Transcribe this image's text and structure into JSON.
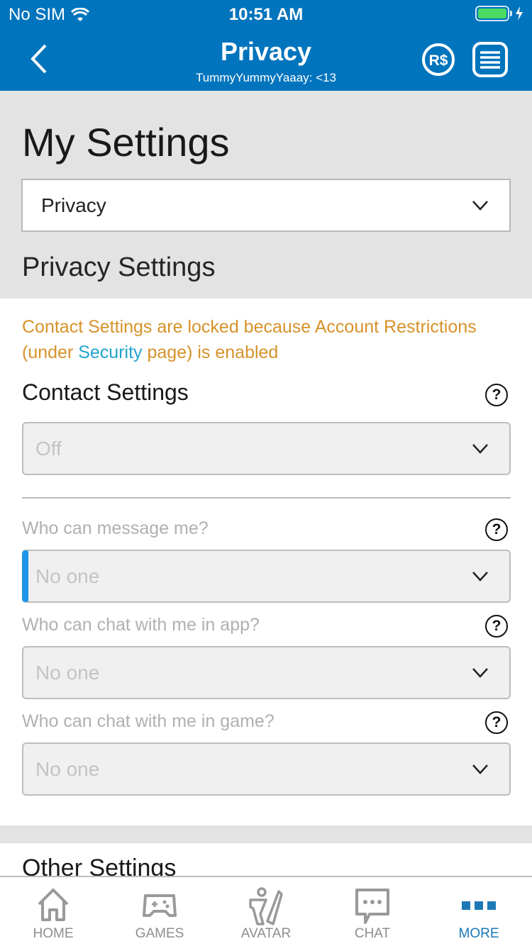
{
  "status_bar": {
    "carrier": "No SIM",
    "time": "10:51 AM"
  },
  "nav": {
    "title": "Privacy",
    "subtitle": "TummyYummyYaaay: <13",
    "back_icon": "chevron-left-icon",
    "robux_icon": "robux-icon",
    "menu_icon": "list-menu-icon"
  },
  "header": {
    "title": "My Settings",
    "category_select": "Privacy",
    "section_title": "Privacy Settings"
  },
  "warning": {
    "prefix": "Contact Settings are locked because Account Restrictions (under ",
    "link": "Security",
    "suffix": " page) is enabled"
  },
  "contact": {
    "label": "Contact Settings",
    "value": "Off",
    "fields": [
      {
        "label": "Who can message me?",
        "value": "No one"
      },
      {
        "label": "Who can chat with me in app?",
        "value": "No one"
      },
      {
        "label": "Who can chat with me in game?",
        "value": "No one"
      }
    ]
  },
  "other": {
    "title": "Other Settings"
  },
  "tabbar": {
    "items": [
      {
        "label": "HOME",
        "icon": "home-icon"
      },
      {
        "label": "GAMES",
        "icon": "gamepad-icon"
      },
      {
        "label": "AVATAR",
        "icon": "avatar-icon"
      },
      {
        "label": "CHAT",
        "icon": "chat-icon"
      },
      {
        "label": "MORE",
        "icon": "more-icon",
        "active": true
      }
    ]
  },
  "colors": {
    "brand": "#0074bd",
    "warning": "#d6922a",
    "link": "#22a4cc",
    "active_tab": "#1c79b5",
    "focus": "#1e95e6"
  }
}
